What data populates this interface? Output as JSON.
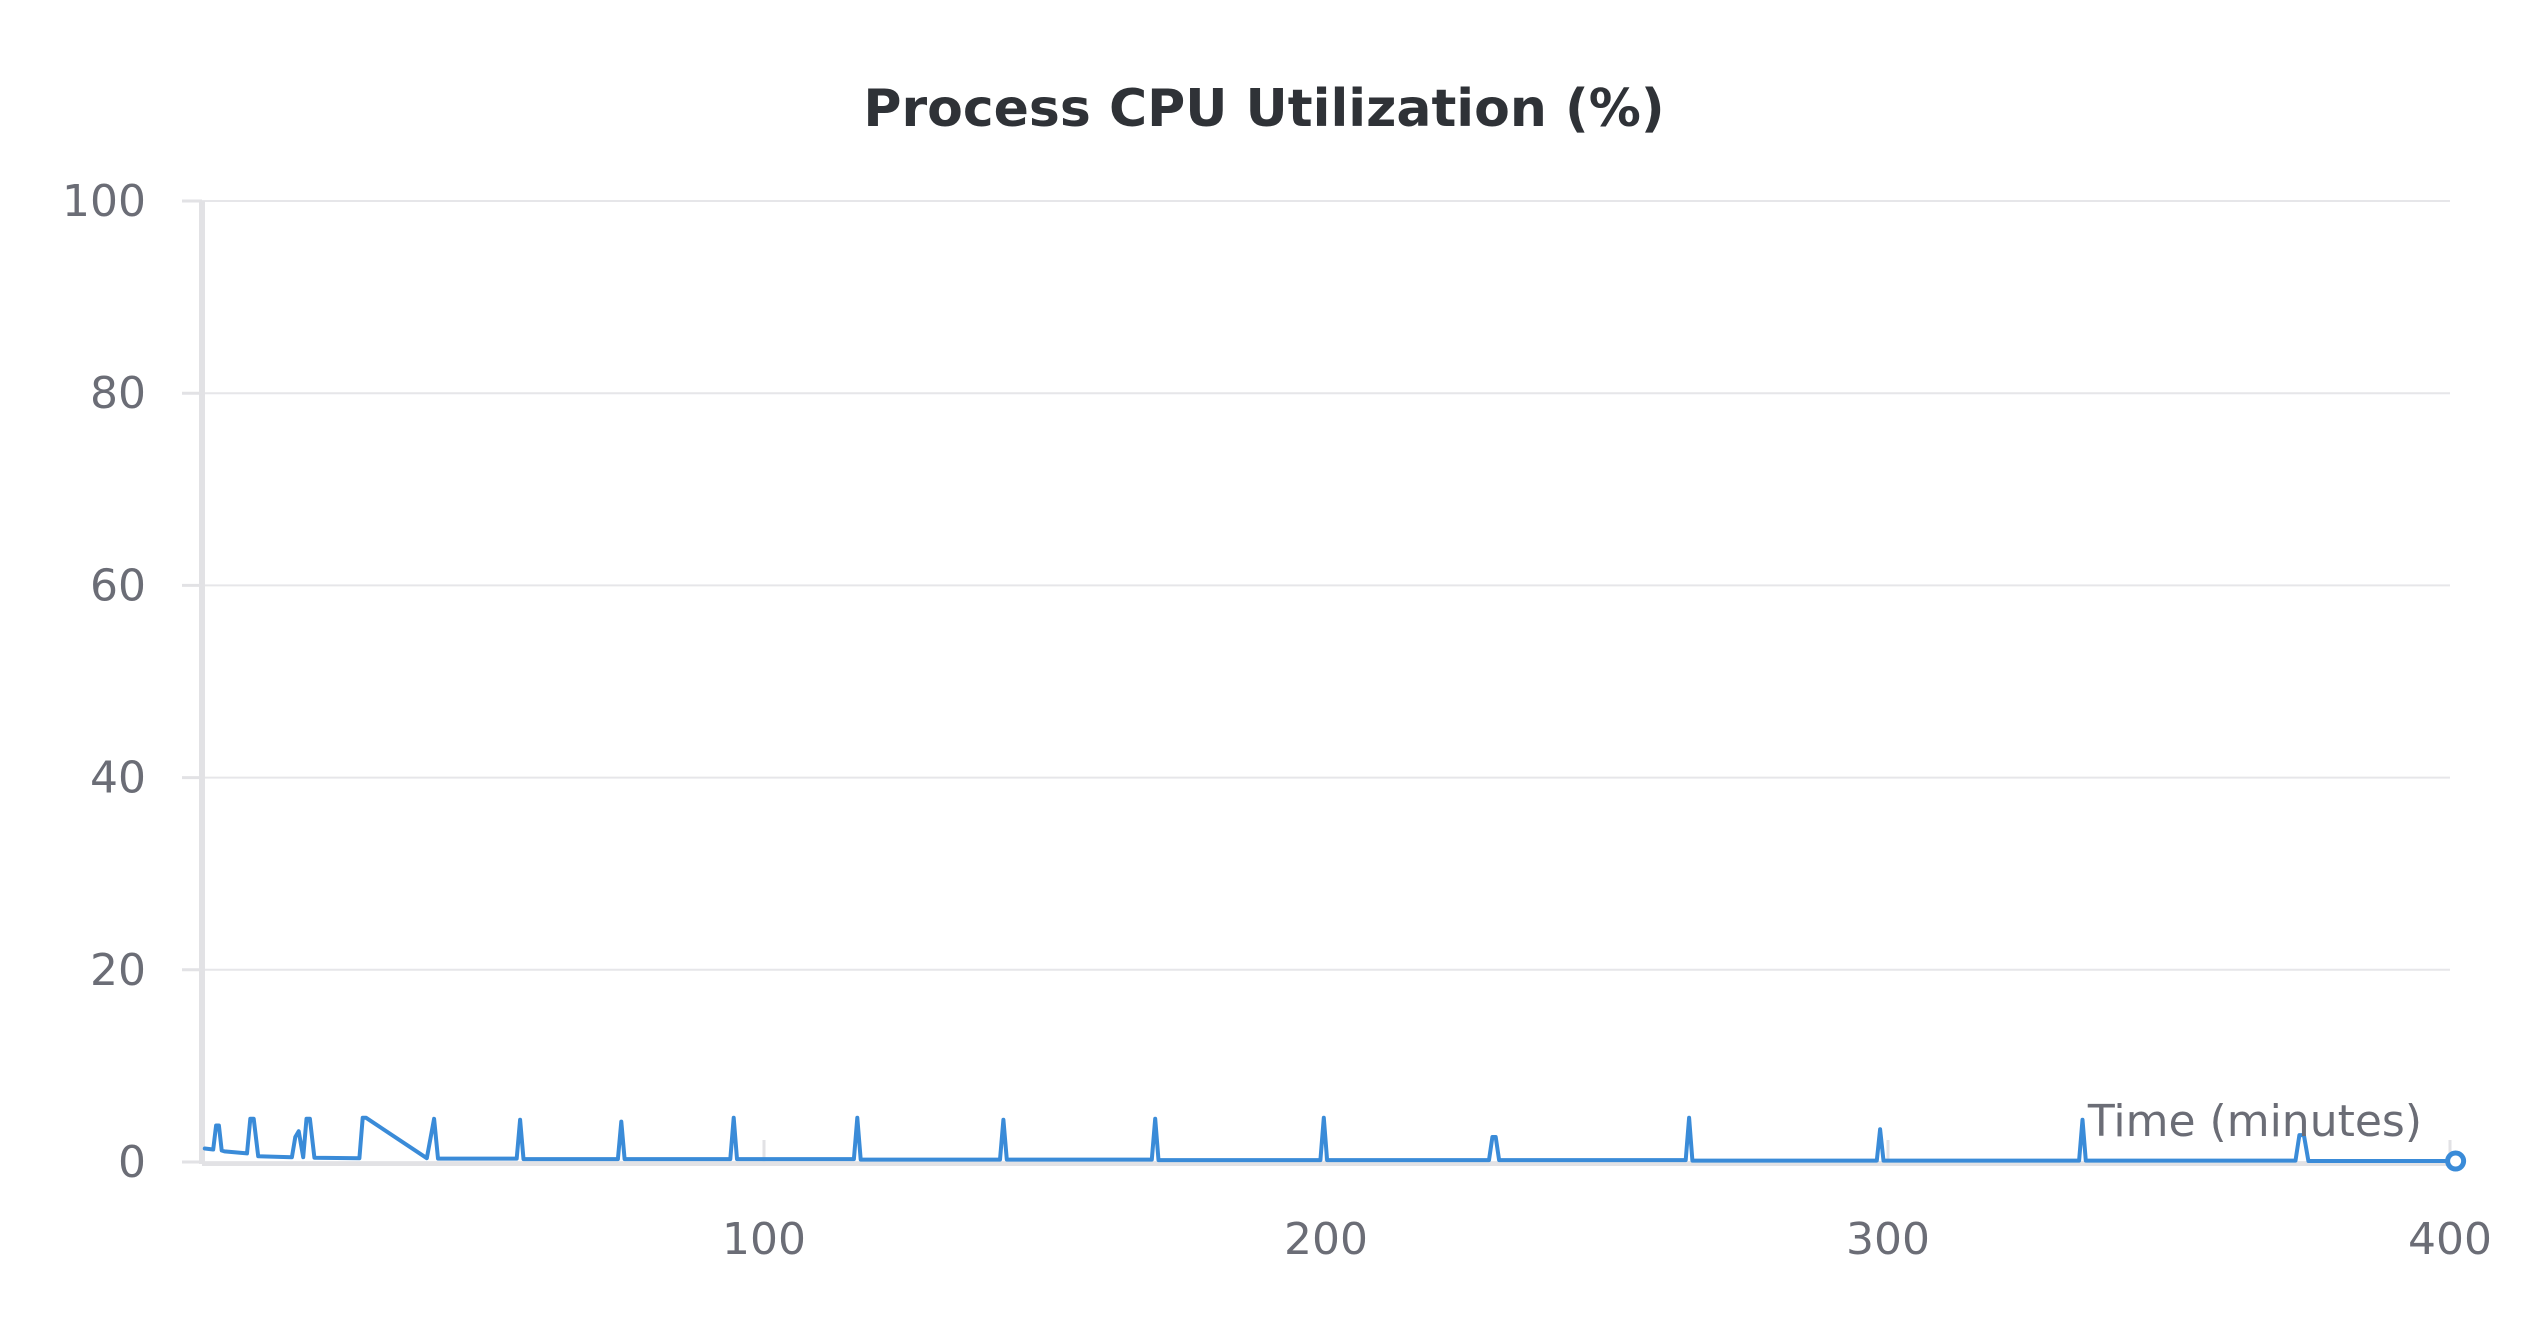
{
  "chart_data": {
    "type": "line",
    "title": "Process CPU Utilization (%)",
    "xlabel": "Time (minutes)",
    "ylabel": "",
    "xlim": [
      0,
      400
    ],
    "ylim": [
      0,
      100
    ],
    "x_ticks": [
      100,
      200,
      300,
      400
    ],
    "y_ticks": [
      0,
      20,
      40,
      60,
      80,
      100
    ],
    "grid": true,
    "series": [
      {
        "color": "#3a8bd8",
        "x": [
          0.5,
          2,
          2.5,
          3,
          3.5,
          4,
          8,
          8.6,
          9.2,
          10,
          16,
          16.6,
          17.2,
          18,
          18.6,
          19.2,
          20,
          28,
          28.6,
          29.2,
          40,
          41.3,
          42,
          56,
          56.6,
          57.2,
          74,
          74.6,
          75.2,
          94,
          94.6,
          95.2,
          116,
          116.6,
          117.2,
          142,
          142.6,
          143.2,
          169,
          169.6,
          170.2,
          199,
          199.6,
          200.2,
          229,
          229.6,
          230.2,
          230.8,
          264,
          264.6,
          265.2,
          298,
          298.6,
          299.2,
          334,
          334.6,
          335.2,
          372.5,
          373.2,
          374,
          374.8,
          401
        ],
        "values": [
          1.4,
          1.3,
          3.8,
          3.8,
          1.2,
          1.1,
          0.9,
          4.5,
          4.5,
          0.6,
          0.5,
          2.6,
          3.2,
          0.5,
          4.5,
          4.5,
          0.45,
          0.4,
          4.6,
          4.6,
          0.4,
          4.5,
          0.35,
          0.35,
          4.4,
          0.3,
          0.3,
          4.2,
          0.3,
          0.3,
          4.6,
          0.3,
          0.3,
          4.6,
          0.25,
          0.25,
          4.4,
          0.25,
          0.25,
          4.5,
          0.2,
          0.2,
          4.6,
          0.2,
          0.2,
          2.6,
          2.6,
          0.2,
          0.2,
          4.6,
          0.15,
          0.15,
          3.4,
          0.15,
          0.15,
          4.4,
          0.15,
          0.15,
          2.8,
          2.8,
          0.1,
          0.1
        ]
      }
    ]
  }
}
